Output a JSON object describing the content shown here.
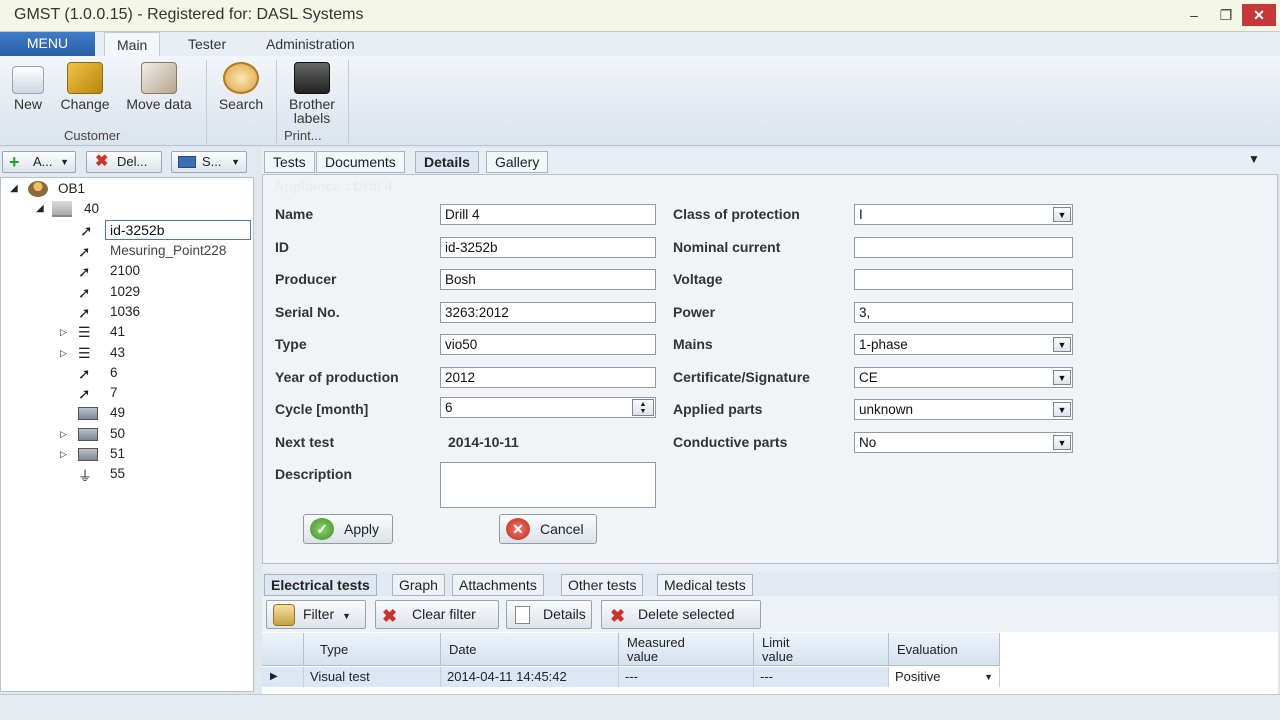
{
  "window": {
    "title": "GMST (1.0.0.15) - Registered for: DASL Systems"
  },
  "ribbon": {
    "menu_label": "MENU",
    "tabs": [
      "Main",
      "Tester",
      "Administration"
    ],
    "buttons": {
      "new": "New",
      "change": "Change",
      "move": "Move data",
      "search": "Search",
      "brother": "Brother labels"
    },
    "groups": {
      "customer": "Customer",
      "print": "Print..."
    }
  },
  "left_toolbar": {
    "add": "A...",
    "delete": "Del...",
    "select": "S..."
  },
  "tree": {
    "root": "OB1",
    "n40": "40",
    "edit_value": "id-3252b",
    "items": [
      "Mesuring_Point228",
      "2100",
      "1029",
      "1036",
      "41",
      "43",
      "6",
      "7",
      "49",
      "50",
      "51",
      "55"
    ]
  },
  "detail_tabs": [
    "Tests",
    "Documents",
    "Details",
    "Gallery"
  ],
  "appliance_title": "Appliance : Drill 4",
  "form": {
    "name_label": "Name",
    "name": "Drill 4",
    "id_label": "ID",
    "id": "id-3252b",
    "producer_label": "Producer",
    "producer": "Bosh",
    "serial_label": "Serial No.",
    "serial": "3263:2012",
    "type_label": "Type",
    "type": "vio50",
    "year_label": "Year of production",
    "year": "2012",
    "cycle_label": "Cycle [month]",
    "cycle": "6",
    "next_label": "Next test",
    "next": "2014-10-11",
    "desc_label": "Description",
    "desc": "",
    "class_label": "Class of protection",
    "class": "I",
    "current_label": "Nominal current",
    "current": "",
    "voltage_label": "Voltage",
    "voltage": "",
    "power_label": "Power",
    "power": "3,",
    "mains_label": "Mains",
    "mains": "1-phase",
    "cert_label": "Certificate/Signature",
    "cert": "CE",
    "applied_label": "Applied parts",
    "applied": "unknown",
    "conductive_label": "Conductive parts",
    "conductive": "No",
    "apply": "Apply",
    "cancel": "Cancel"
  },
  "bottom_tabs": [
    "Electrical tests",
    "Graph",
    "Attachments",
    "Other tests",
    "Medical tests"
  ],
  "bottom_toolbar": {
    "filter": "Filter",
    "clear": "Clear filter",
    "details": "Details",
    "delete": "Delete selected"
  },
  "grid": {
    "headers": [
      "Type",
      "Date",
      "Measured value",
      "Limit value",
      "Evaluation"
    ],
    "rows": [
      [
        "Visual test",
        "2014-04-11 14:45:42",
        "---",
        "---",
        "Positive"
      ]
    ]
  }
}
